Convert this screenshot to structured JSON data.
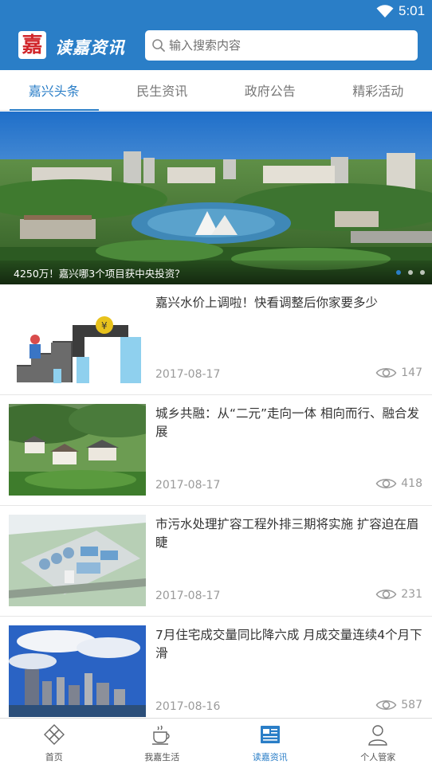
{
  "status_bar": {
    "time": "5:01"
  },
  "header": {
    "logo_char": "嘉",
    "app_title": "读嘉资讯",
    "search_placeholder": "输入搜索内容"
  },
  "tabs": [
    {
      "label": "嘉兴头条",
      "active": true
    },
    {
      "label": "民生资讯",
      "active": false
    },
    {
      "label": "政府公告",
      "active": false
    },
    {
      "label": "精彩活动",
      "active": false
    }
  ],
  "banner": {
    "caption": "4250万！嘉兴哪3个项目获中央投资？",
    "slide_count": 3,
    "active_slide": 0
  },
  "news": [
    {
      "title": "嘉兴水价上调啦！快看调整后你家要多少",
      "date": "2017-08-17",
      "views": "147",
      "thumb": "water-price-illustration"
    },
    {
      "title": "城乡共融：从“二元”走向一体 相向而行、融合发展",
      "date": "2017-08-17",
      "views": "418",
      "thumb": "rural-village-photo"
    },
    {
      "title": "市污水处理扩容工程外排三期将实施 扩容迫在眉睫",
      "date": "2017-08-17",
      "views": "231",
      "thumb": "sewage-plant-photo"
    },
    {
      "title": "7月住宅成交量同比降六成 月成交量连续4个月下滑",
      "date": "2017-08-16",
      "views": "587",
      "thumb": "city-skyline-photo"
    }
  ],
  "bottom_nav": [
    {
      "label": "首页",
      "icon": "diamond-grid-icon",
      "active": false
    },
    {
      "label": "我嘉生活",
      "icon": "coffee-cup-icon",
      "active": false
    },
    {
      "label": "读嘉资讯",
      "icon": "newspaper-icon",
      "active": true
    },
    {
      "label": "个人管家",
      "icon": "person-icon",
      "active": false
    }
  ],
  "colors": {
    "primary": "#2a7ec7",
    "logo_red": "#d1262b",
    "muted_text": "#9a9a9a"
  }
}
